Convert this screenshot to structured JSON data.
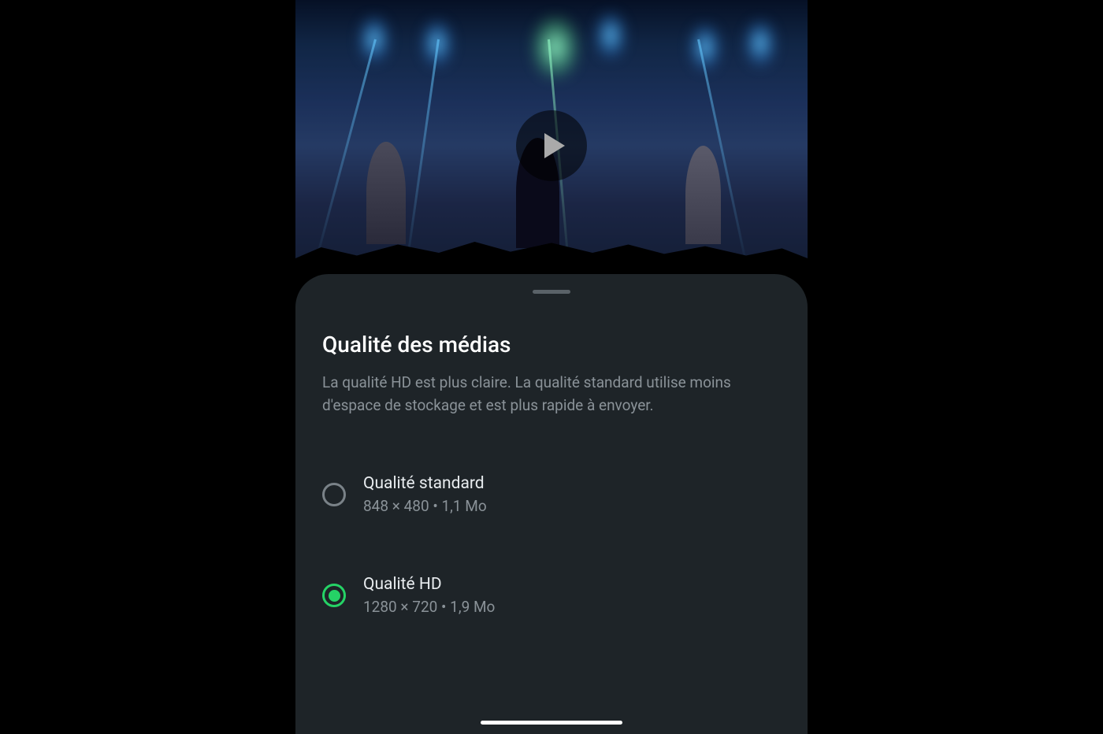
{
  "sheet": {
    "title": "Qualité des médias",
    "description": "La qualité HD est plus claire. La qualité standard utilise moins d'espace de stockage et est plus rapide à envoyer."
  },
  "options": [
    {
      "label": "Qualité standard",
      "detail": "848 × 480 • 1,1 Mo",
      "selected": false
    },
    {
      "label": "Qualité HD",
      "detail": "1280 × 720 • 1,9 Mo",
      "selected": true
    }
  ]
}
